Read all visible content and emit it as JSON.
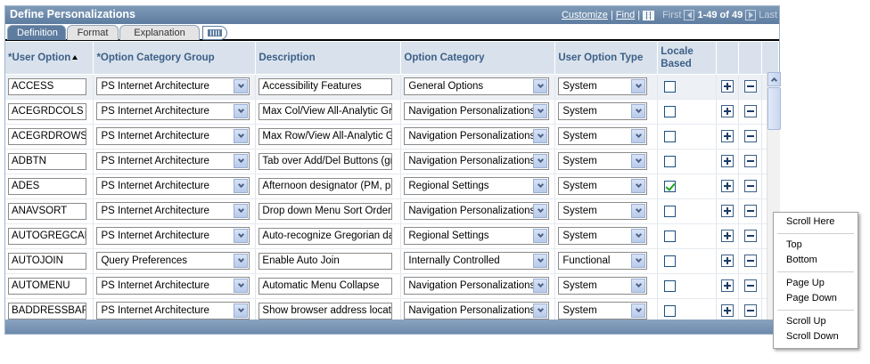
{
  "title": "Define Personalizations",
  "nav": {
    "customize": "Customize",
    "find": "Find",
    "first": "First",
    "range": "1-49 of 49",
    "last": "Last",
    "view_all_icon": "grid-view-icon",
    "prev_icon": "arrow-left-icon",
    "next_icon": "arrow-right-icon"
  },
  "tabs": [
    {
      "label": "Definition",
      "active": true
    },
    {
      "label": "Format",
      "active": false
    },
    {
      "label": "Explanation",
      "active": false
    }
  ],
  "columns": {
    "user_option": "*User Option",
    "option_category_group": "*Option Category Group",
    "description": "Description",
    "option_category": "Option Category",
    "user_option_type": "User Option Type",
    "locale_based": "Locale Based"
  },
  "rows": [
    {
      "user_option": "ACCESS",
      "group": "PS Internet Architecture",
      "description": "Accessibility Features",
      "category": "General Options",
      "type": "System",
      "locale": false
    },
    {
      "user_option": "ACEGRDCOLS",
      "group": "PS Internet Architecture",
      "description": "Max Col/View All-Analytic Grid",
      "category": "Navigation Personalizations",
      "type": "System",
      "locale": false
    },
    {
      "user_option": "ACEGRDROWS",
      "group": "PS Internet Architecture",
      "description": "Max Row/View All-Analytic Grid",
      "category": "Navigation Personalizations",
      "type": "System",
      "locale": false
    },
    {
      "user_option": "ADBTN",
      "group": "PS Internet Architecture",
      "description": "Tab over Add/Del Buttons (grid)",
      "category": "Navigation Personalizations",
      "type": "System",
      "locale": false
    },
    {
      "user_option": "ADES",
      "group": "PS Internet Architecture",
      "description": "Afternoon designator (PM, pm)",
      "category": "Regional Settings",
      "type": "System",
      "locale": true
    },
    {
      "user_option": "ANAVSORT",
      "group": "PS Internet Architecture",
      "description": "Drop down Menu Sort Order",
      "category": "Navigation Personalizations",
      "type": "System",
      "locale": false
    },
    {
      "user_option": "AUTOGREGCAL",
      "group": "PS Internet Architecture",
      "description": "Auto-recognize Gregorian dates",
      "category": "Regional Settings",
      "type": "System",
      "locale": false
    },
    {
      "user_option": "AUTOJOIN",
      "group": "Query Preferences",
      "description": "Enable Auto Join",
      "category": "Internally Controlled",
      "type": "Functional",
      "locale": false
    },
    {
      "user_option": "AUTOMENU",
      "group": "PS Internet Architecture",
      "description": "Automatic Menu Collapse",
      "category": "Navigation Personalizations",
      "type": "System",
      "locale": false
    },
    {
      "user_option": "BADDRESSBAR",
      "group": "PS Internet Architecture",
      "description": "Show browser address location",
      "category": "Navigation Personalizations",
      "type": "System",
      "locale": false
    }
  ],
  "context_menu": {
    "scroll_here": "Scroll Here",
    "top": "Top",
    "bottom": "Bottom",
    "page_up": "Page Up",
    "page_down": "Page Down",
    "scroll_up": "Scroll Up",
    "scroll_down": "Scroll Down"
  },
  "colors": {
    "header_blue": "#5d7c9f",
    "column_header_bg": "#d9e2ec",
    "column_header_text": "#3c5f87",
    "check_green": "#21a121"
  }
}
